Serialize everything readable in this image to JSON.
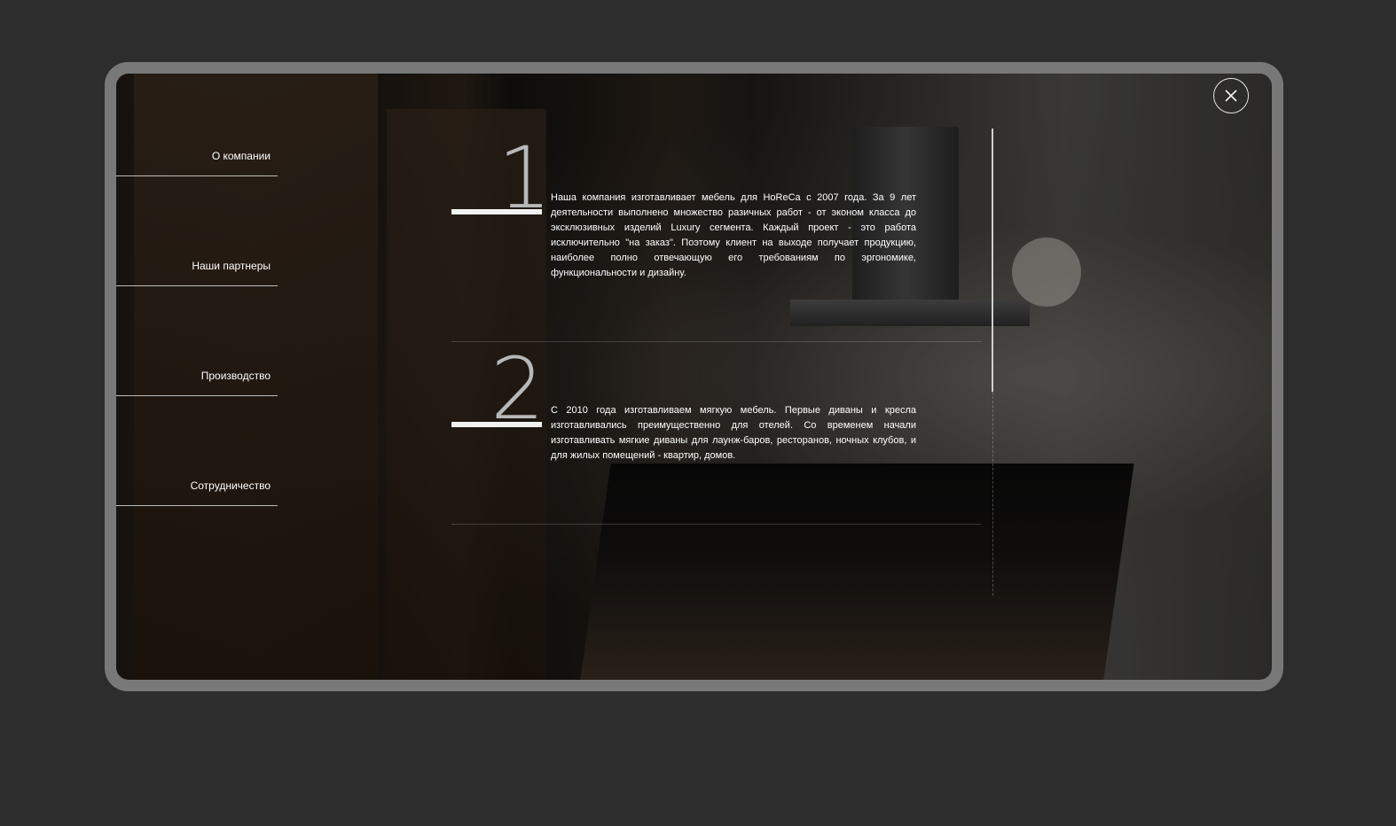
{
  "close_icon": "close-icon",
  "menu": {
    "items": [
      {
        "label": "О компании"
      },
      {
        "label": "Наши партнеры"
      },
      {
        "label": "Производство"
      },
      {
        "label": "Сотрудничество"
      }
    ]
  },
  "sections": [
    {
      "number": "1",
      "text": "Наша компания изготавливает мебель для HoReCa с 2007 года. За 9 лет деятельности выполнено множество разичных работ - от эконом класса до эксклюзивных изделий Luxury сегмента. Каждый проект - это работа исключительно \"на заказ\". Поэтому клиент на выходе получает продукцию, наиболее полно отвечающую его требованиям по эргономике, функциональности и дизайну."
    },
    {
      "number": "2",
      "text": "С 2010 года изготавливаем мягкую мебель. Первые диваны и кресла изготавливались преимущественно для отелей. Со временем начали изготавливать мягкие диваны для лаунж-баров, ресторанов, ночных клубов, и для жилых помещений - квартир, домов."
    }
  ],
  "colors": {
    "page_background": "#2d2d2d",
    "frame": "#787878",
    "text": "#ffffff",
    "number": "#b8b8b8"
  }
}
